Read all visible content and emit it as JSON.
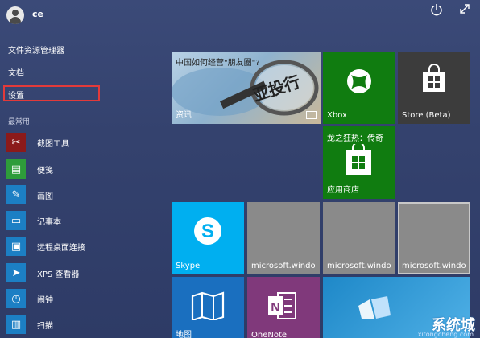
{
  "user": {
    "name": "ce"
  },
  "controls": {
    "power_icon": "power-icon",
    "expand_icon": "expand-icon"
  },
  "menu": {
    "file_explorer": "文件资源管理器",
    "documents": "文档",
    "settings": "设置",
    "most_used_label": "最常用"
  },
  "apps": [
    {
      "label": "截图工具",
      "icon": "scissors-icon",
      "color": "#8b1a1a"
    },
    {
      "label": "便笺",
      "icon": "sticky-notes-icon",
      "color": "#2e9c3a"
    },
    {
      "label": "画图",
      "icon": "paint-icon",
      "color": "#1c7fc4"
    },
    {
      "label": "记事本",
      "icon": "notepad-icon",
      "color": "#1c7fc4"
    },
    {
      "label": "远程桌面连接",
      "icon": "remote-desktop-icon",
      "color": "#1c7fc4"
    },
    {
      "label": "XPS 查看器",
      "icon": "xps-viewer-icon",
      "color": "#1c7fc4"
    },
    {
      "label": "闹钟",
      "icon": "alarm-icon",
      "color": "#1c7fc4"
    },
    {
      "label": "扫描",
      "icon": "scan-icon",
      "color": "#1c7fc4"
    }
  ],
  "tiles": {
    "news": {
      "headline": "中国如何经营\"朋友圈\"?",
      "label": "资讯",
      "image_text": "亚投行"
    },
    "xbox": {
      "label": "Xbox",
      "color": "#107c10"
    },
    "store": {
      "label": "Store (Beta)",
      "color": "#3c3c3c"
    },
    "app_store": {
      "title": "龙之狂热：传奇",
      "label": "应用商店",
      "color": "#107c10"
    },
    "skype": {
      "label": "Skype",
      "color": "#00aff0"
    },
    "ms1": {
      "label": "microsoft.windo"
    },
    "ms2": {
      "label": "microsoft.windo"
    },
    "ms3": {
      "label": "microsoft.windo"
    },
    "maps": {
      "label": "地图",
      "color": "#1a6fbf"
    },
    "onenote": {
      "label": "OneNote",
      "color": "#80397b"
    }
  },
  "watermark": {
    "text": "系统城",
    "sub": "xitongcheng.com"
  }
}
